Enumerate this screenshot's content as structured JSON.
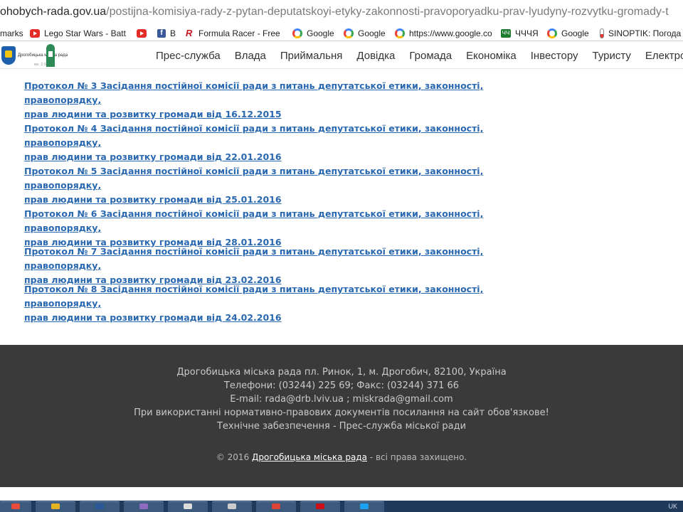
{
  "browser": {
    "url_host": "ohobych-rada.gov.ua",
    "url_path": "/postijna-komisiya-rady-z-pytan-deputatskoyi-etyky-zakonnosti-pravoporyadku-prav-lyudyny-rozvytku-gromady-t",
    "bookmarks": [
      {
        "icon": "bookmarks-icon",
        "label": "marks"
      },
      {
        "icon": "youtube-icon",
        "label": "Lego Star Wars - Batt"
      },
      {
        "icon": "youtube-icon",
        "label": ""
      },
      {
        "icon": "facebook-icon",
        "label": "В"
      },
      {
        "icon": "formula-racer-icon",
        "label": "Formula Racer - Free"
      },
      {
        "icon": "google-icon",
        "label": "Google"
      },
      {
        "icon": "google-icon",
        "label": "Google"
      },
      {
        "icon": "google-icon",
        "label": "https://www.google.co"
      },
      {
        "icon": "chchch-icon",
        "label": "ЧЧЧЯ"
      },
      {
        "icon": "google-icon",
        "label": "Google"
      },
      {
        "icon": "sinoptik-icon",
        "label": "SINOPTIK: Погода"
      }
    ]
  },
  "site": {
    "logo_text": "Дрогобицька міська рада",
    "logo_version": "вв. 2.0",
    "nav": [
      "Прес-служба",
      "Влада",
      "Приймальня",
      "Довідка",
      "Громада",
      "Економіка",
      "Інвестору",
      "Туристу",
      "Електронн"
    ]
  },
  "protocols": [
    {
      "line1": "Протокол № 3 Засідання постійної комісії ради з питань депутатської етики, законності, правопорядку,",
      "line2": "прав людини та розвитку громади від 16.12.2015"
    },
    {
      "line1": "Протокол № 4 Засідання постійної комісії ради з питань депутатської етики, законності, правопорядку,",
      "line2": "прав людини та розвитку громади від 22.01.2016"
    },
    {
      "line1": "Протокол № 5 Засідання постійної комісії ради з питань депутатської етики, законності, правопорядку,",
      "line2": "прав людини та розвитку громади від 25.01.2016"
    },
    {
      "line1": "Протокол № 6 Засідання постійної комісії ради з питань депутатської етики, законності, правопорядку,",
      "line2": "прав людини та розвитку громади від 28.01.2016"
    },
    {
      "line1": "Протокол № 7 Засідання постійної комісії ради з питань депутатської етики, законності, правопорядку,",
      "line2": "прав людини та розвитку громади від 23.02.2016"
    },
    {
      "line1": "Протокол № 8 Засідання постійної комісії ради з питань депутатської етики, законності, правопорядку,",
      "line2": "прав людини та розвитку громади від 24.02.2016"
    }
  ],
  "footer": {
    "address": "Дрогобицька міська рада пл. Ринок, 1, м. Дрогобич, 82100, Україна",
    "phones": "Телефони: (03244) 225 69; Факс: (03244) 371 66",
    "email": "E-mail: rada@drb.lviv.ua ; miskrada@gmail.com",
    "notice": "При використанні нормативно-правових документів посилання на сайт обов'язкове!",
    "support": "Технічне забезпечення - Прес-служба міської ради",
    "copyright_prefix": "© 2016",
    "copyright_site": "Дрогобицька міська рада",
    "copyright_suffix": "- всі права захищено."
  },
  "taskbar": {
    "items": [
      "start",
      "explorer",
      "word",
      "app",
      "app",
      "app",
      "chrome",
      "opera",
      "twitter"
    ],
    "clock": "UK"
  },
  "colors": {
    "link": "#2a68b0",
    "footer_bg": "#3a3a3a",
    "taskbar_bg": "#1f3a5a"
  }
}
